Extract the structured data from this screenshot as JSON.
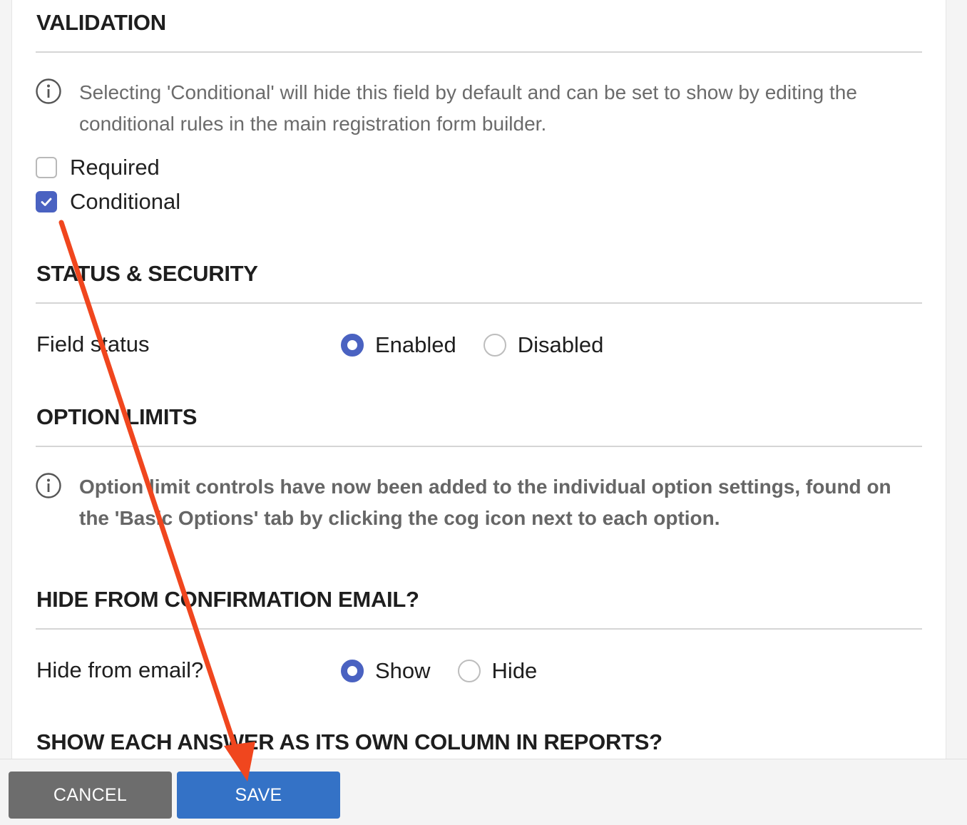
{
  "validation": {
    "title": "VALIDATION",
    "info_text": "Selecting 'Conditional' will hide this field by default and can be set to show by editing the conditional rules in the main registration form builder.",
    "options": [
      {
        "label": "Required",
        "checked": false
      },
      {
        "label": "Conditional",
        "checked": true
      }
    ]
  },
  "status_security": {
    "title": "STATUS & SECURITY",
    "field_label": "Field status",
    "options": [
      {
        "label": "Enabled",
        "selected": true
      },
      {
        "label": "Disabled",
        "selected": false
      }
    ]
  },
  "option_limits": {
    "title": "OPTION LIMITS",
    "info_text": "Option limit controls have now been added to the individual option settings, found on the 'Basic Options' tab by clicking the cog icon next to each option."
  },
  "hide_confirmation": {
    "title": "HIDE FROM CONFIRMATION EMAIL?",
    "field_label": "Hide from email?",
    "options": [
      {
        "label": "Show",
        "selected": true
      },
      {
        "label": "Hide",
        "selected": false
      }
    ]
  },
  "show_answer_columns": {
    "title": "SHOW EACH ANSWER AS ITS OWN COLUMN IN REPORTS?"
  },
  "footer": {
    "cancel_label": "CANCEL",
    "save_label": "SAVE"
  },
  "colors": {
    "accent": "#4a62c1",
    "save_button": "#3472c6",
    "cancel_button": "#6d6d6d",
    "annotation_arrow": "#f0461e"
  },
  "icons": {
    "info": "info-icon",
    "check": "check-icon",
    "arrow": "arrow-annotation"
  }
}
